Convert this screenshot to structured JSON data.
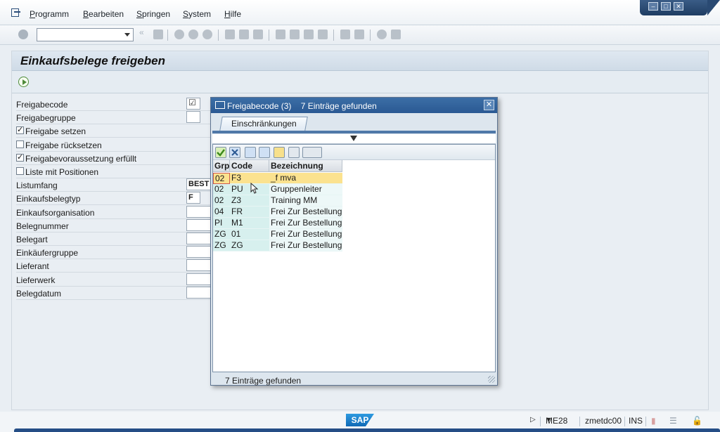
{
  "menu": {
    "items": [
      {
        "acc": "P",
        "rest": "rogramm"
      },
      {
        "acc": "B",
        "rest": "earbeiten"
      },
      {
        "acc": "S",
        "rest": "pringen"
      },
      {
        "acc": "S",
        "rest": "ystem"
      },
      {
        "acc": "H",
        "rest": "ilfe"
      }
    ]
  },
  "toolbar": {
    "command_field_value": ""
  },
  "page": {
    "title": "Einkaufsbelege freigeben"
  },
  "form": {
    "rows": [
      {
        "label": "Freigabecode",
        "type": "field",
        "value": ""
      },
      {
        "label": "Freigabegruppe",
        "type": "field",
        "value": ""
      },
      {
        "label": "Freigabe setzen",
        "type": "checkbox",
        "checked": true
      },
      {
        "label": "Freigabe rücksetzen",
        "type": "checkbox",
        "checked": false
      },
      {
        "label": "Freigabevoraussetzung erfüllt",
        "type": "checkbox",
        "checked": true
      },
      {
        "label": "Liste mit Positionen",
        "type": "checkbox",
        "checked": false
      },
      {
        "label": "Listumfang",
        "type": "field",
        "value": "BEST"
      },
      {
        "label": "Einkaufsbelegtyp",
        "type": "field",
        "value": "F"
      },
      {
        "label": "Einkaufsorganisation",
        "type": "field",
        "value": ""
      },
      {
        "label": "Belegnummer",
        "type": "field",
        "value": ""
      },
      {
        "label": "Belegart",
        "type": "field",
        "value": ""
      },
      {
        "label": "Einkäufergruppe",
        "type": "field",
        "value": ""
      },
      {
        "label": "Lieferant",
        "type": "field",
        "value": ""
      },
      {
        "label": "Lieferwerk",
        "type": "field",
        "value": ""
      },
      {
        "label": "Belegdatum",
        "type": "field",
        "value": ""
      }
    ]
  },
  "dialog": {
    "title": "Freigabecode (3)",
    "count": "7 Einträge gefunden",
    "close": "✕",
    "tab": "Einschränkungen",
    "columns": [
      "Grp",
      "Code",
      "Bezeichnung"
    ],
    "rows": [
      {
        "grp": "02",
        "code": "F3",
        "desc": "_f mva",
        "selected": true
      },
      {
        "grp": "02",
        "code": "PU",
        "desc": "Gruppenleiter",
        "selected": false
      },
      {
        "grp": "02",
        "code": "Z3",
        "desc": "Training MM",
        "selected": false
      },
      {
        "grp": "04",
        "code": "FR",
        "desc": "Frei Zur Bestellung",
        "selected": false
      },
      {
        "grp": "PI",
        "code": "M1",
        "desc": "Frei Zur Bestellung",
        "selected": false
      },
      {
        "grp": "ZG",
        "code": "01",
        "desc": "Frei Zur Bestellung",
        "selected": false
      },
      {
        "grp": "ZG",
        "code": "ZG",
        "desc": "Frei Zur Bestellung",
        "selected": false
      }
    ],
    "status": "7 Einträge gefunden"
  },
  "statusbar": {
    "logo": "SAP",
    "transaction": "ME28",
    "server": "zmetdc00",
    "mode": "INS"
  },
  "colors": {
    "title_blue": "#2a5993",
    "selected_row": "#fbe28f",
    "grid_teal": "#d7f0ee",
    "accent_green": "#4f8a3b"
  }
}
